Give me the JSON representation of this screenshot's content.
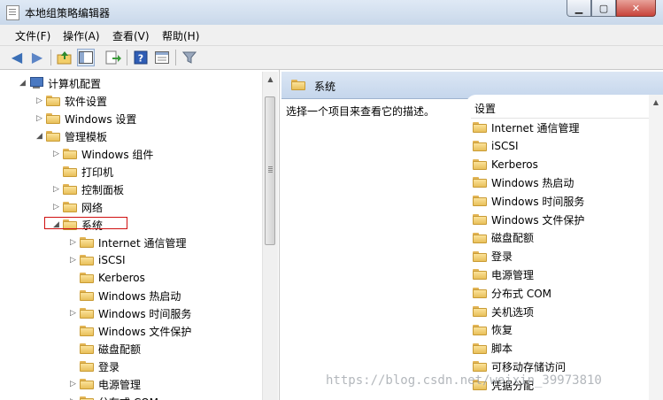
{
  "window": {
    "title": "本地组策略编辑器"
  },
  "menu": [
    "文件(F)",
    "操作(A)",
    "查看(V)",
    "帮助(H)"
  ],
  "toolbar": [
    "back-arrow-icon",
    "forward-arrow-icon",
    "up-folder-icon",
    "show-hide-tree-icon",
    "export-icon",
    "help-icon",
    "properties-icon",
    "filter-icon"
  ],
  "tree": [
    {
      "label": "计算机配置",
      "level": 0,
      "expander": "open",
      "icon": "computer"
    },
    {
      "label": "软件设置",
      "level": 1,
      "expander": "closed"
    },
    {
      "label": "Windows 设置",
      "level": 1,
      "expander": "closed"
    },
    {
      "label": "管理模板",
      "level": 1,
      "expander": "open"
    },
    {
      "label": "Windows 组件",
      "level": 2,
      "expander": "closed"
    },
    {
      "label": "打印机",
      "level": 2,
      "expander": "none"
    },
    {
      "label": "控制面板",
      "level": 2,
      "expander": "closed"
    },
    {
      "label": "网络",
      "level": 2,
      "expander": "closed"
    },
    {
      "label": "系统",
      "level": 2,
      "expander": "open"
    },
    {
      "label": "Internet 通信管理",
      "level": 3,
      "expander": "closed"
    },
    {
      "label": "iSCSI",
      "level": 3,
      "expander": "closed"
    },
    {
      "label": "Kerberos",
      "level": 3,
      "expander": "none"
    },
    {
      "label": "Windows 热启动",
      "level": 3,
      "expander": "none"
    },
    {
      "label": "Windows 时间服务",
      "level": 3,
      "expander": "closed"
    },
    {
      "label": "Windows 文件保护",
      "level": 3,
      "expander": "none"
    },
    {
      "label": "磁盘配额",
      "level": 3,
      "expander": "none"
    },
    {
      "label": "登录",
      "level": 3,
      "expander": "none"
    },
    {
      "label": "电源管理",
      "level": 3,
      "expander": "closed"
    },
    {
      "label": "分布式 COM",
      "level": 3,
      "expander": "closed"
    }
  ],
  "right": {
    "header_title": "系统",
    "description": "选择一个项目来查看它的描述。",
    "column_header": "设置",
    "items": [
      "Internet 通信管理",
      "iSCSI",
      "Kerberos",
      "Windows 热启动",
      "Windows 时间服务",
      "Windows 文件保护",
      "磁盘配额",
      "登录",
      "电源管理",
      "分布式 COM",
      "关机选项",
      "恢复",
      "脚本",
      "可移动存储访问",
      "凭据分配"
    ]
  },
  "watermark": "https://blog.csdn.net/weixin_39973810",
  "colors": {
    "highlight_box": "#d01010",
    "titlebar": "#c9d8ea"
  }
}
